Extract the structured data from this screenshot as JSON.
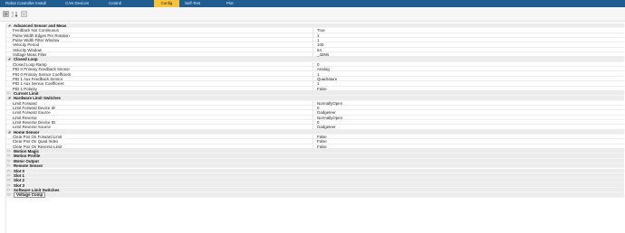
{
  "tabs": [
    {
      "label": "Robot Controller Install",
      "active": false
    },
    {
      "label": "CAN Devices",
      "active": false
    },
    {
      "label": "Control",
      "active": false
    },
    {
      "label": "Config",
      "active": true
    },
    {
      "label": "Self-Test",
      "active": false
    },
    {
      "label": "Plot",
      "active": false
    }
  ],
  "toolbar": {
    "categorized_icon": "categorized-view-icon",
    "sort_icon": "alphabetical-sort-icon",
    "pages_icon": "property-pages-icon"
  },
  "grid": {
    "rows": [
      {
        "type": "category",
        "label": "Advanced Sensor and Meas",
        "expanded": true
      },
      {
        "type": "property",
        "label": "Feedback Not Continuous",
        "value": "True"
      },
      {
        "type": "property",
        "label": "Pulse Width Edges Per Rotation",
        "value": "1"
      },
      {
        "type": "property",
        "label": "Pulse Width Filter Window",
        "value": "1"
      },
      {
        "type": "property",
        "label": "Velocity Period",
        "value": "100"
      },
      {
        "type": "property",
        "label": "Velocity Window",
        "value": "64"
      },
      {
        "type": "property",
        "label": "Voltage Meas Filter",
        "value": "_32Ms"
      },
      {
        "type": "category",
        "label": "Closed Loop",
        "expanded": true
      },
      {
        "type": "property",
        "label": "Closed Loop Ramp",
        "value": "0"
      },
      {
        "type": "property",
        "label": "PID 0 Primary Feedback Sensor",
        "value": "Analog"
      },
      {
        "type": "property",
        "label": "PID 0 Primary Sensor Coefficient",
        "value": "1"
      },
      {
        "type": "property",
        "label": "PID 1 Aux Feedback Sensor",
        "value": "Quadrature"
      },
      {
        "type": "property",
        "label": "PID 1 Aux Sensor Coefficient",
        "value": "1"
      },
      {
        "type": "property",
        "label": "PID 1 Polarity",
        "value": "False"
      },
      {
        "type": "category",
        "label": "Current Limit",
        "expanded": false
      },
      {
        "type": "category",
        "label": "Hardware Limit Switches",
        "expanded": true
      },
      {
        "type": "property",
        "label": "Limit Forward",
        "value": "NormallyOpen"
      },
      {
        "type": "property",
        "label": "Limit Forward Device ID",
        "value": "0"
      },
      {
        "type": "property",
        "label": "Limit Forward Source",
        "value": "Gadgeteer"
      },
      {
        "type": "property",
        "label": "Limit Reverse",
        "value": "NormallyOpen"
      },
      {
        "type": "property",
        "label": "Limit Reverse Device ID",
        "value": "0"
      },
      {
        "type": "property",
        "label": "Limit Reverse Source",
        "value": "Gadgeteer"
      },
      {
        "type": "category",
        "label": "Home Sensor",
        "expanded": true
      },
      {
        "type": "property",
        "label": "Clear Pos On Forward Limit",
        "value": "False"
      },
      {
        "type": "property",
        "label": "Clear Pos On Quad Index",
        "value": "False"
      },
      {
        "type": "property",
        "label": "Clear Pos On Reverse Limit",
        "value": "False"
      },
      {
        "type": "category",
        "label": "Motion Magic",
        "expanded": false
      },
      {
        "type": "category",
        "label": "Motion Profile",
        "expanded": false
      },
      {
        "type": "category",
        "label": "Motor Output",
        "expanded": false
      },
      {
        "type": "category",
        "label": "Remote Sensor",
        "expanded": false
      },
      {
        "type": "category",
        "label": "Slot 0",
        "expanded": false
      },
      {
        "type": "category",
        "label": "Slot 1",
        "expanded": false
      },
      {
        "type": "category",
        "label": "Slot 2",
        "expanded": false
      },
      {
        "type": "category",
        "label": "Slot 3",
        "expanded": false
      },
      {
        "type": "category",
        "label": "Software Limit Switches",
        "expanded": false
      },
      {
        "type": "category",
        "label": "Voltage Comp",
        "expanded": false,
        "selected": true
      }
    ]
  }
}
